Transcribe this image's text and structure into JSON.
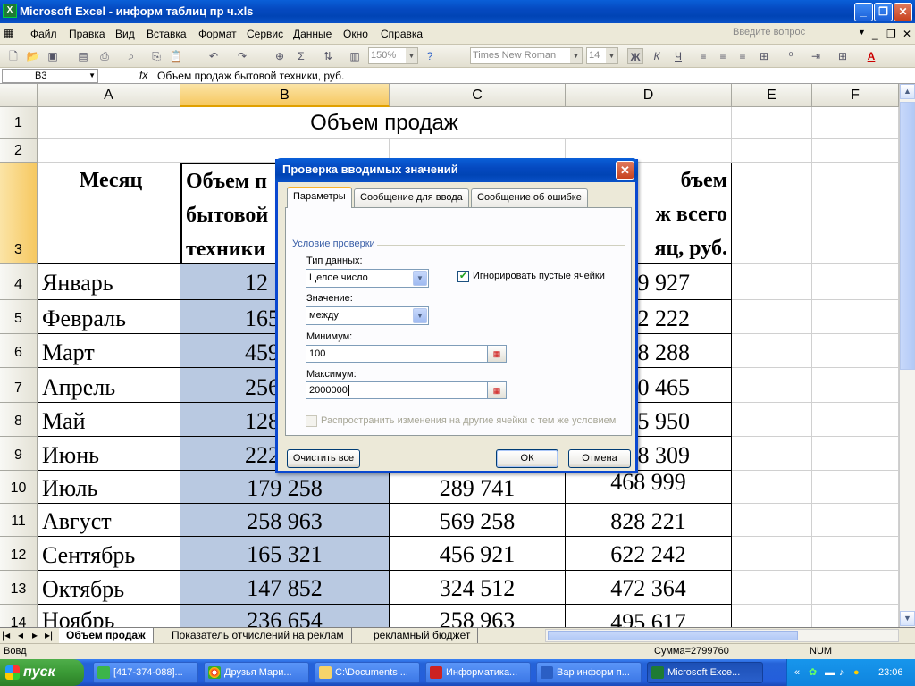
{
  "window": {
    "title": "Microsoft Excel - информ таблиц пр ч.xls",
    "app_icon": "X"
  },
  "menu": {
    "items": [
      "Файл",
      "Правка",
      "Вид",
      "Вставка",
      "Формат",
      "Сервис",
      "Данные",
      "Окно",
      "Справка"
    ],
    "help_placeholder": "Введите вопрос"
  },
  "toolbar": {
    "zoom": "150%",
    "font": "Times New Roman",
    "size": "14",
    "bold": "Ж",
    "italic": "К",
    "underline": "Ч",
    "sigma": "Σ"
  },
  "formula_bar": {
    "cell_ref": "B3",
    "fx": "fx",
    "content": "Объем продаж бытовой техники, руб."
  },
  "columns": [
    "A",
    "B",
    "C",
    "D",
    "E",
    "F"
  ],
  "rows": [
    "1",
    "2",
    "3",
    "4",
    "5",
    "6",
    "7",
    "8",
    "9",
    "10",
    "11",
    "12",
    "13",
    "14"
  ],
  "sheet": {
    "title": "Объем продаж",
    "header_a": "Месяц",
    "header_b": [
      "Объем п",
      "бытовой",
      "техники"
    ],
    "header_d": [
      "бъем",
      "ж всего",
      "яц, руб."
    ],
    "data": [
      {
        "month": "Январь",
        "b": "12",
        "c": "",
        "d": "9 927"
      },
      {
        "month": "Февраль",
        "b": "165",
        "c": "",
        "d": "2 222"
      },
      {
        "month": "Март",
        "b": "459",
        "c": "",
        "d": "8 288"
      },
      {
        "month": "Апрель",
        "b": "256",
        "c": "",
        "d": "0 465"
      },
      {
        "month": "Май",
        "b": "128",
        "c": "",
        "d": "5 950"
      },
      {
        "month": "Июнь",
        "b": "222",
        "c": "",
        "d": "8 309"
      },
      {
        "month": "Июль",
        "b": "179 258",
        "c": "289 741",
        "d": "468 999"
      },
      {
        "month": "Август",
        "b": "258 963",
        "c": "569 258",
        "d": "828 221"
      },
      {
        "month": "Сентябрь",
        "b": "165 321",
        "c": "456 921",
        "d": "622 242"
      },
      {
        "month": "Октябрь",
        "b": "147 852",
        "c": "324 512",
        "d": "472 364"
      },
      {
        "month": "Ноябрь",
        "b": "236 654",
        "c": "258 963",
        "d": "495 617"
      }
    ]
  },
  "sheet_tabs": [
    "Объем продаж",
    "Показатель отчислений на реклам",
    "рекламный бюджет"
  ],
  "status": {
    "left": "Вовд",
    "sum": "Сумма=2799760",
    "num": "NUM"
  },
  "dialog": {
    "title": "Проверка вводимых значений",
    "tabs": [
      "Параметры",
      "Сообщение для ввода",
      "Сообщение об ошибке"
    ],
    "group": "Условие проверки",
    "type_label": "Тип данных:",
    "type_value": "Целое число",
    "ignore_blank": "Игнорировать пустые ячейки",
    "value_label": "Значение:",
    "value_value": "между",
    "min_label": "Минимум:",
    "min_value": "100",
    "max_label": "Максимум:",
    "max_value": "2000000",
    "propagate": "Распространить изменения на другие ячейки с тем же условием",
    "clear_button": "Очистить все",
    "ok_button": "ОК",
    "cancel_button": "Отмена"
  },
  "taskbar": {
    "start": "пуск",
    "tasks": [
      "[417-374-088]...",
      "Друзья Мари...",
      "C:\\Documents ...",
      "Информатика...",
      "Вар информ п...",
      "Microsoft Exce..."
    ],
    "clock": "23:06"
  }
}
